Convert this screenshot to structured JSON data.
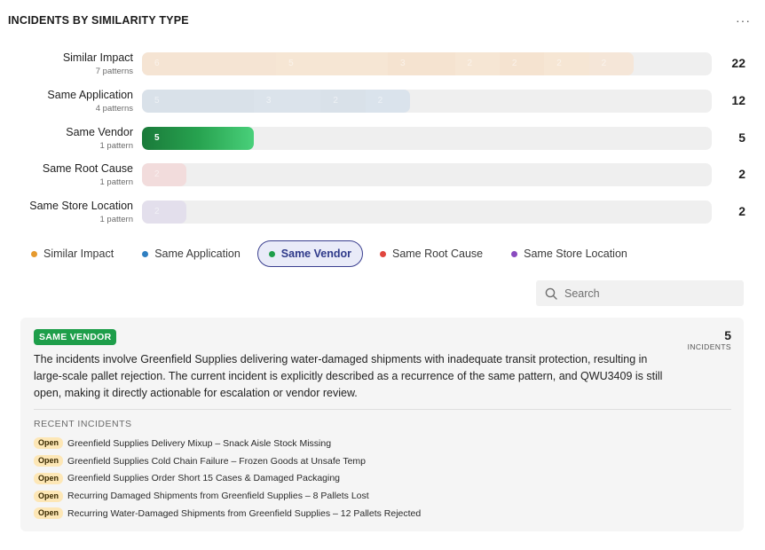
{
  "header": {
    "title": "INCIDENTS BY SIMILARITY TYPE",
    "more_label": "···"
  },
  "rows": [
    {
      "name": "Similar Impact",
      "sub": "7 patterns",
      "count": "22",
      "color": "#e69a2e",
      "segments": [
        {
          "value": 6,
          "label": "6",
          "bg": "#f5e4d3"
        },
        {
          "value": 5,
          "label": "5",
          "bg": "#f6e6d4"
        },
        {
          "value": 3,
          "label": "3",
          "bg": "#f5e3d0"
        },
        {
          "value": 2,
          "label": "2",
          "bg": "#f6e6d4"
        },
        {
          "value": 2,
          "label": "2",
          "bg": "#f5e3d0"
        },
        {
          "value": 2,
          "label": "2",
          "bg": "#f6e6d4"
        },
        {
          "value": 2,
          "label": "2",
          "bg": "#f5e6d8"
        }
      ]
    },
    {
      "name": "Same Application",
      "sub": "4 patterns",
      "count": "12",
      "color": "#2f7fc1",
      "segments": [
        {
          "value": 5,
          "label": "5",
          "bg": "#d9e1e9"
        },
        {
          "value": 3,
          "label": "3",
          "bg": "#dbe3eb"
        },
        {
          "value": 2,
          "label": "2",
          "bg": "#d9e1e9"
        },
        {
          "value": 2,
          "label": "2",
          "bg": "#dae3ec"
        }
      ]
    },
    {
      "name": "Same Vendor",
      "sub": "1 pattern",
      "count": "5",
      "color": "#1e9e4a",
      "active": true,
      "segments": [
        {
          "value": 5,
          "label": "5",
          "bg": "linear-gradient(90deg, #1a7a3a 0%, #27a24f 50%, #49d07a 100%)"
        }
      ]
    },
    {
      "name": "Same Root Cause",
      "sub": "1 pattern",
      "count": "2",
      "color": "#e0463e",
      "segments": [
        {
          "value": 2,
          "label": "2",
          "bg": "#f2dcdc"
        }
      ]
    },
    {
      "name": "Same Store Location",
      "sub": "1 pattern",
      "count": "2",
      "color": "#8a4bbf",
      "segments": [
        {
          "value": 2,
          "label": "2",
          "bg": "#e3dfec"
        }
      ]
    }
  ],
  "legend": [
    {
      "label": "Similar Impact",
      "color": "#e69a2e",
      "active": false
    },
    {
      "label": "Same Application",
      "color": "#2f7fc1",
      "active": false
    },
    {
      "label": "Same Vendor",
      "color": "#1e9e4a",
      "active": true
    },
    {
      "label": "Same Root Cause",
      "color": "#e0463e",
      "active": false
    },
    {
      "label": "Same Store Location",
      "color": "#8a4bbf",
      "active": false
    }
  ],
  "search": {
    "placeholder": "Search",
    "icon": "search-icon"
  },
  "detail": {
    "badge": "SAME VENDOR",
    "count": "5",
    "count_label": "INCIDENTS",
    "description": "The incidents involve Greenfield Supplies delivering water-damaged shipments with inadequate transit protection, resulting in large-scale pallet rejection. The current incident is explicitly described as a recurrence of the same pattern, and QWU3409 is still open, making it directly actionable for escalation or vendor review.",
    "recent_title": "RECENT INCIDENTS",
    "incidents": [
      {
        "status": "Open",
        "title": "Greenfield Supplies Delivery Mixup – Snack Aisle Stock Missing"
      },
      {
        "status": "Open",
        "title": "Greenfield Supplies Cold Chain Failure – Frozen Goods at Unsafe Temp"
      },
      {
        "status": "Open",
        "title": "Greenfield Supplies Order Short 15 Cases & Damaged Packaging"
      },
      {
        "status": "Open",
        "title": "Recurring Damaged Shipments from Greenfield Supplies – 8 Pallets Lost"
      },
      {
        "status": "Open",
        "title": "Recurring Water-Damaged Shipments from Greenfield Supplies – 12 Pallets Rejected"
      }
    ]
  }
}
